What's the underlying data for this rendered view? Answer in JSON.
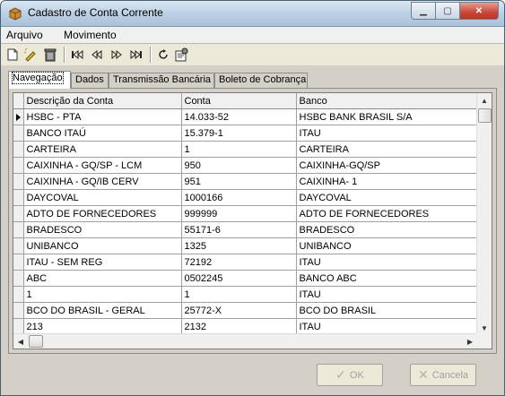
{
  "window": {
    "title": "Cadastro de Conta Corrente"
  },
  "menu": [
    "Arquivo",
    "Movimento"
  ],
  "toolbar": {
    "icons": [
      "new-document-icon",
      "edit-pencil-icon",
      "delete-trash-icon",
      "first-record-icon",
      "previous-record-icon",
      "next-record-icon",
      "last-record-icon",
      "refresh-icon",
      "properties-icon"
    ]
  },
  "tabs": [
    "Navegação",
    "Dados",
    "Transmissão Bancária",
    "Boleto de Cobrança"
  ],
  "grid": {
    "columns": [
      "Descrição da Conta",
      "Conta",
      "Banco"
    ],
    "rows": [
      [
        "HSBC - PTA",
        "14.033-52",
        "HSBC BANK BRASIL S/A"
      ],
      [
        "BANCO ITAÚ",
        "15.379-1",
        "ITAU"
      ],
      [
        "CARTEIRA",
        "1",
        "CARTEIRA"
      ],
      [
        "CAIXINHA - GQ/SP - LCM",
        "950",
        "CAIXINHA-GQ/SP"
      ],
      [
        "CAIXINHA - GQ/IB CERV",
        "951",
        "CAIXINHA- 1"
      ],
      [
        "DAYCOVAL",
        "1000166",
        "DAYCOVAL"
      ],
      [
        "ADTO DE FORNECEDORES",
        "999999",
        "ADTO DE FORNECEDORES"
      ],
      [
        "BRADESCO",
        "55171-6",
        "BRADESCO"
      ],
      [
        "UNIBANCO",
        "1325",
        "UNIBANCO"
      ],
      [
        "ITAU - SEM REG",
        "72192",
        "ITAU"
      ],
      [
        "ABC",
        "0502245",
        "BANCO ABC"
      ],
      [
        "1",
        "1",
        "ITAU"
      ],
      [
        "BCO DO BRASIL - GERAL",
        "25772-X",
        "BCO DO BRASIL"
      ],
      [
        "213",
        "2132",
        "ITAU"
      ]
    ]
  },
  "buttons": {
    "ok": "OK",
    "cancel": "Cancela"
  }
}
